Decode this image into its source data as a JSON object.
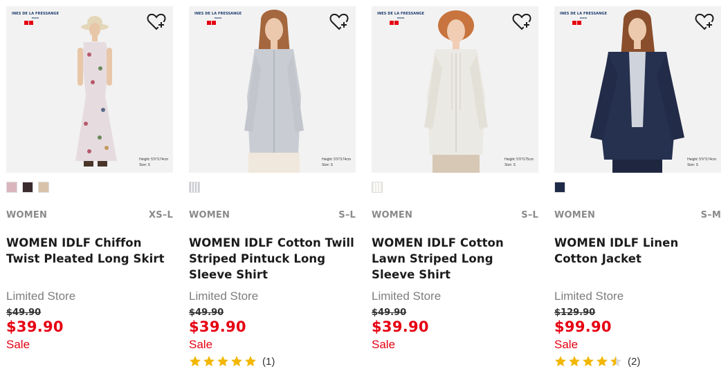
{
  "colors": {
    "accent": "#e60012",
    "star": "#f2b705"
  },
  "products": [
    {
      "brand": "INES DE LA FRESSANGE",
      "brand_sub": "PARIS",
      "model_height": "Height: 5'9\"/174cm",
      "model_size": "Size: S",
      "category": "WOMEN",
      "size_range": "XS–L",
      "name": "WOMEN IDLF Chiffon Twist Pleated Long Skirt",
      "store": "Limited Store",
      "original_price": "$49.90",
      "price": "$39.90",
      "sale": "Sale",
      "swatches": [
        "#d9b6bd",
        "#3b2a2e",
        "#d8c2a9"
      ]
    },
    {
      "brand": "INES DE LA FRESSANGE",
      "brand_sub": "PARIS",
      "model_height": "Height: 5'9\"/174cm",
      "model_size": "Size: S",
      "category": "WOMEN",
      "size_range": "S–L",
      "name": "WOMEN IDLF Cotton Twill Striped Pintuck Long Sleeve Shirt",
      "store": "Limited Store",
      "original_price": "$49.90",
      "price": "$39.90",
      "sale": "Sale",
      "rating": 5,
      "review_count": "(1)",
      "swatches": [
        "#c9ccd2"
      ]
    },
    {
      "brand": "INES DE LA FRESSANGE",
      "brand_sub": "PARIS",
      "model_height": "Height: 5'9\"/175cm",
      "model_size": "Size: S",
      "category": "WOMEN",
      "size_range": "S–L",
      "name": "WOMEN IDLF Cotton Lawn Striped Long Sleeve Shirt",
      "store": "Limited Store",
      "original_price": "$49.90",
      "price": "$39.90",
      "sale": "Sale",
      "swatches": [
        "#ebe9e3"
      ]
    },
    {
      "brand": "INES DE LA FRESSANGE",
      "brand_sub": "PARIS",
      "model_height": "Height: 5'9\"/174cm",
      "model_size": "Size: S",
      "category": "WOMEN",
      "size_range": "S–M",
      "name": "WOMEN IDLF Linen Cotton Jacket",
      "store": "Limited Store",
      "original_price": "$129.90",
      "price": "$99.90",
      "sale": "Sale",
      "rating": 4.5,
      "review_count": "(2)",
      "swatches": [
        "#1f2a48"
      ]
    }
  ]
}
